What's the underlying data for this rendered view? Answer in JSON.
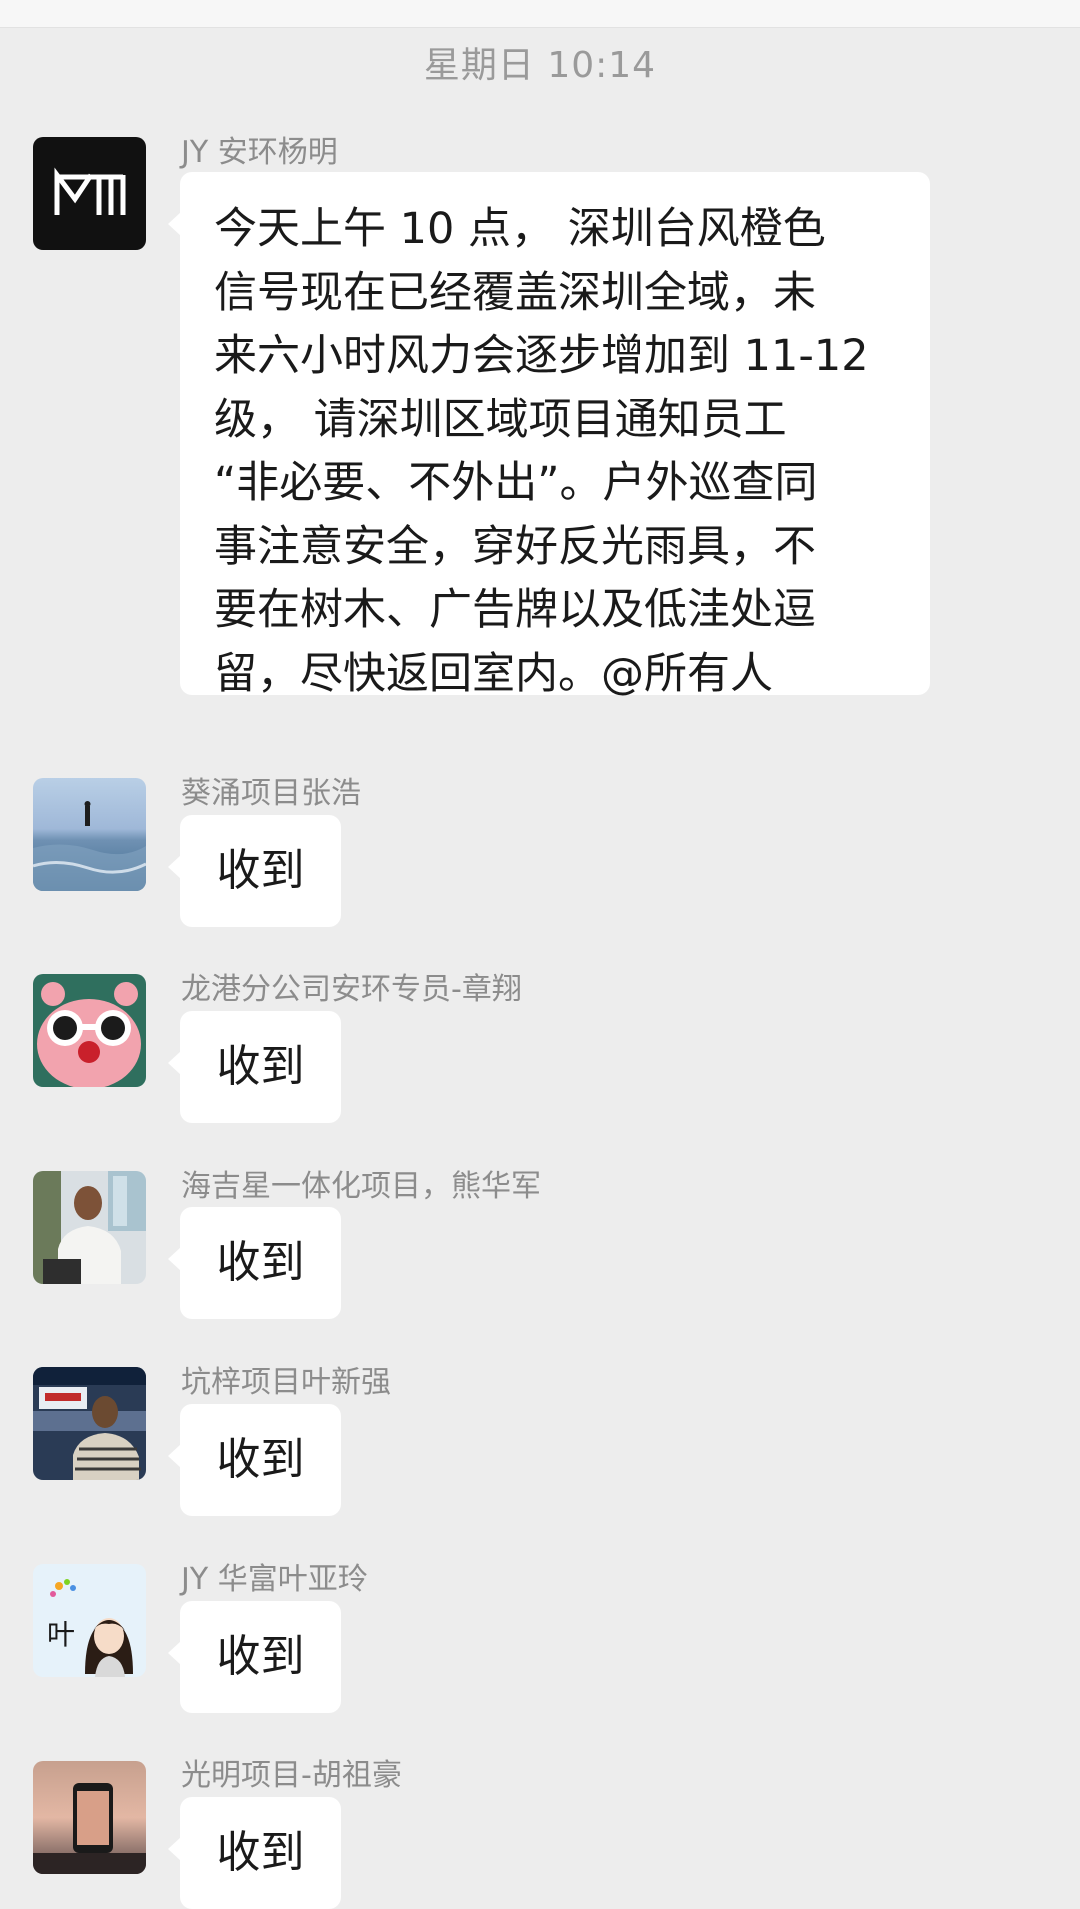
{
  "chat": {
    "timestamp": "星期日 10:14",
    "messages": [
      {
        "sender": "JY 安环杨明",
        "avatar": "m-logo-icon",
        "lines": [
          "今天上午 10 点， 深圳台风橙色",
          "信号现在已经覆盖深圳全域，未",
          "来六小时风力会逐步增加到 11-12",
          "级， 请深圳区域项目通知员工",
          "“非必要、不外出”。户外巡查同",
          "事注意安全，穿好反光雨具，不",
          "要在树木、广告牌以及低洼处逗",
          "留，尽快返回室内。@所有人"
        ]
      },
      {
        "sender": "葵涌项目张浩",
        "avatar": "beach-photo-icon",
        "text": "收到"
      },
      {
        "sender": "龙港分公司安环专员-章翔",
        "avatar": "pink-character-sunglasses-icon",
        "text": "收到"
      },
      {
        "sender": "海吉星一体化项目，熊华军",
        "avatar": "man-portrait-photo-icon",
        "text": "收到"
      },
      {
        "sender": "坑梓项目叶新强",
        "avatar": "man-storefront-photo-icon",
        "text": "收到"
      },
      {
        "sender": "JY 华富叶亚玲",
        "avatar": "cartoon-girl-icon",
        "avatar_text": "叶",
        "text": "收到"
      },
      {
        "sender": "光明项目-胡祖豪",
        "avatar": "sunset-phone-photo-icon",
        "text": "收到"
      }
    ]
  },
  "colors": {
    "background": "#ededed",
    "bubble": "#ffffff",
    "sender_text": "#8c8c8c",
    "timestamp_text": "#9a9a9a",
    "message_text": "#1a1a1a"
  }
}
